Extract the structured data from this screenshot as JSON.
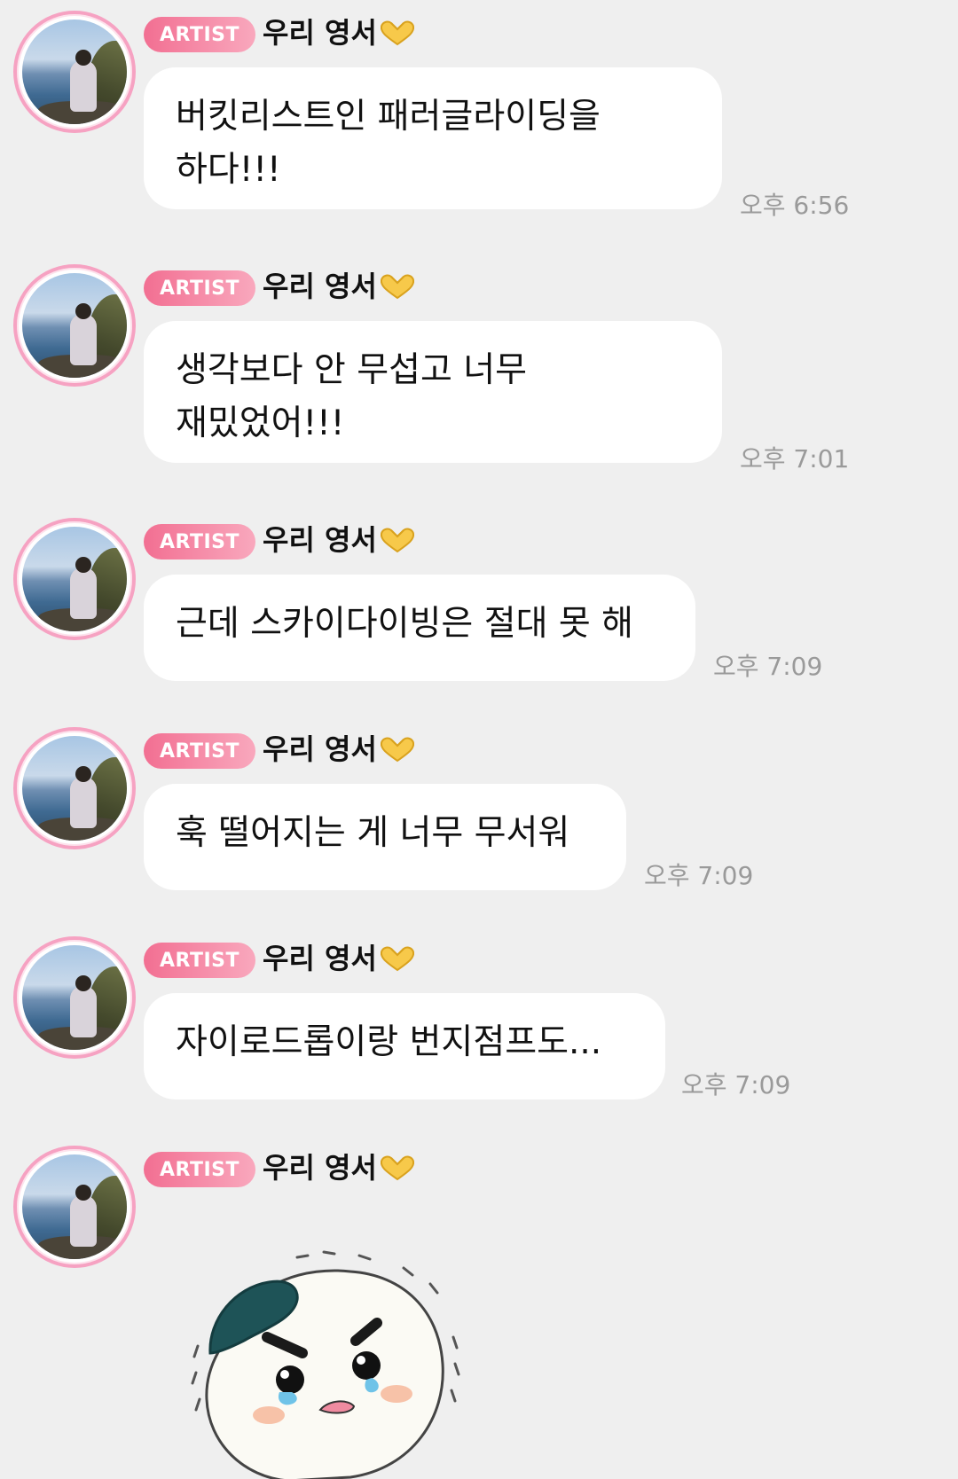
{
  "sender": {
    "badge": "ARTIST",
    "name": "우리 영서",
    "name_emoji_icon": "heart-hands-icon"
  },
  "messages": [
    {
      "text": "버킷리스트인 패러글라이딩을\n하다!!!",
      "time": "오후 6:56"
    },
    {
      "text": "생각보다 안 무섭고 너무\n재밌었어!!!",
      "time": "오후 7:01"
    },
    {
      "text": "근데 스카이다이빙은 절대 못 해",
      "time": "오후 7:09"
    },
    {
      "text": "훅 떨어지는 게 너무 무서워",
      "time": "오후 7:09"
    },
    {
      "text": "자이로드롭이랑 번지점프도...",
      "time": "오후 7:09"
    }
  ],
  "sticker": {
    "icon": "crying-rice-ball-sticker-icon"
  },
  "colors": {
    "background": "#efefef",
    "badge_start": "#f26f92",
    "badge_end": "#f9a8bd",
    "avatar_ring": "#f6a2c2",
    "bubble": "#ffffff",
    "time_text": "#9a9a9a"
  }
}
